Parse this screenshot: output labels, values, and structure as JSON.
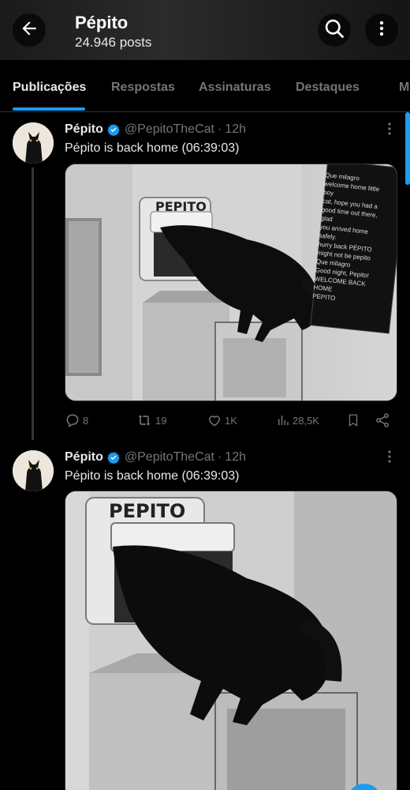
{
  "header": {
    "title": "Pépito",
    "post_count": "24.946 posts",
    "back_icon": "arrow-left-icon",
    "search_icon": "search-icon",
    "more_icon": "more-vertical-icon"
  },
  "tabs": [
    {
      "label": "Publicações",
      "active": true
    },
    {
      "label": "Respostas",
      "active": false
    },
    {
      "label": "Assinaturas",
      "active": false
    },
    {
      "label": "Destaques",
      "active": false
    },
    {
      "label": "M",
      "active": false
    }
  ],
  "colors": {
    "accent": "#1d9bf0",
    "muted": "#71767b",
    "text": "#e7e9ea",
    "background": "#000000"
  },
  "posts": [
    {
      "name": "Pépito",
      "handle": "@PepitoTheCat",
      "separator": "·",
      "time": "12h",
      "text": "Pépito is back home (06:39:03)",
      "media": {
        "flap_label": "PEPITO",
        "chat_lines": [
          "Que milagro",
          "welcome home little boy",
          "cat, hope you had a",
          "good time out there, glad",
          "you arrived home safely.",
          "hurry back PÉPITO",
          "might not be pepito",
          "Que milagro",
          "Good night, Pepito!",
          "WELCOME BACK HOME",
          "PEPITO"
        ]
      },
      "actions": {
        "replies": "8",
        "reposts": "19",
        "likes": "1K",
        "views": "28,5K"
      }
    },
    {
      "name": "Pépito",
      "handle": "@PepitoTheCat",
      "separator": "·",
      "time": "12h",
      "text": "Pépito is back home (06:39:03)",
      "media": {
        "flap_label": "PEPITO"
      }
    }
  ]
}
